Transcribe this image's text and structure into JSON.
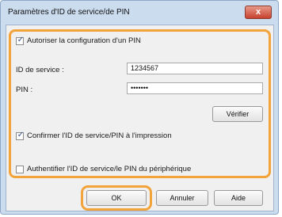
{
  "window": {
    "title": "Paramètres d'ID de service/de PIN",
    "close_glyph": "x"
  },
  "form": {
    "enable_checkbox": {
      "label": "Autoriser la configuration d'un PIN",
      "checked": true
    },
    "service_id": {
      "label": "ID de service :",
      "value": "1234567"
    },
    "pin": {
      "label": "PIN :",
      "value": "•••••••"
    },
    "verify_button": "Vérifier",
    "confirm_checkbox": {
      "label": "Confirmer l'ID de service/PIN à l'impression",
      "checked": true
    },
    "auth_checkbox": {
      "label": "Authentifier l'ID de service/le PIN du périphérique",
      "checked": false
    }
  },
  "buttons": {
    "ok": "OK",
    "cancel": "Annuler",
    "help": "Aide"
  },
  "colors": {
    "highlight": "#f2a33a",
    "title_bar": "#cbdcef",
    "close_button": "#c8412e"
  },
  "check_glyph": "✓"
}
